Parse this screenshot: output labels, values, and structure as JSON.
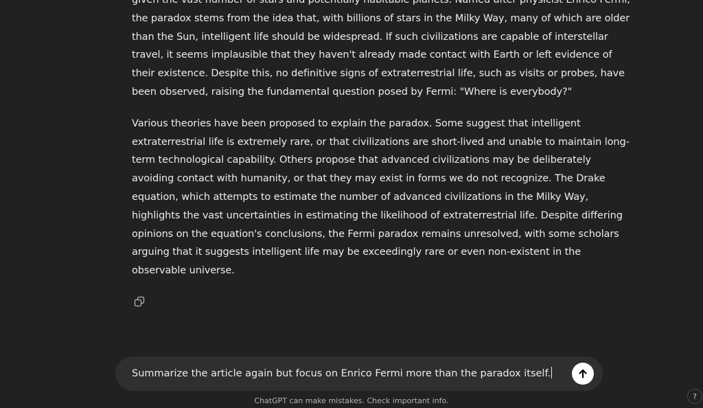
{
  "conversation": {
    "paragraphs": [
      {
        "lines": [
          "given the vast number of stars and potentially habitable planets. Named after physicist Enrico Fermi,",
          "the paradox stems from the idea that, with billions of stars in the Milky Way, many of which are older",
          "than the Sun, intelligent life should be widespread. If such civilizations are capable of interstellar",
          "travel, it seems implausible that they haven't already made contact with Earth or left evidence of",
          "their existence. Despite this, no definitive signs of extraterrestrial life, such as visits or probes, have",
          "been observed, raising the fundamental question posed by Fermi: \"Where is everybody?\""
        ]
      },
      {
        "lines": [
          "Various theories have been proposed to explain the paradox. Some suggest that intelligent",
          "extraterrestrial life is extremely rare, or that civilizations are short-lived and unable to maintain long-",
          "term technological capability. Others propose that advanced civilizations may be deliberately",
          "avoiding contact with humanity, or that they may exist in forms we do not recognize. The Drake",
          "equation, which attempts to estimate the number of advanced civilizations in the Milky Way,",
          "highlights the vast uncertainties in estimating the likelihood of extraterrestrial life. Despite differing",
          "opinions on the equation's conclusions, the Fermi paradox remains unresolved, with some scholars",
          "arguing that it suggests intelligent life may be exceedingly rare or even non-existent in the",
          "observable universe."
        ]
      }
    ],
    "actions": {
      "copy_icon": "copy-icon"
    }
  },
  "composer": {
    "value": "Summarize the article again but focus on Enrico Fermi more than the paradox itself.",
    "send_icon": "arrow-up-icon"
  },
  "footer": {
    "disclaimer": "ChatGPT can make mistakes. Check important info.",
    "help_label": "?"
  },
  "colors": {
    "background": "#212121",
    "composer_background": "#2f2f2f",
    "text": "#ececec",
    "muted_text": "#b4b4b4",
    "send_button": "#ffffff"
  }
}
